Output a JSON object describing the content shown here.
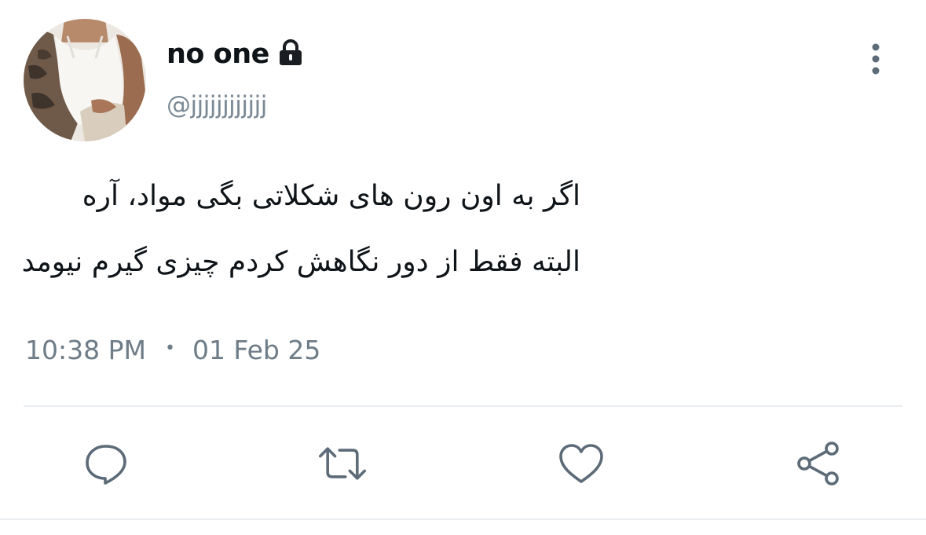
{
  "user": {
    "display_name": "no one",
    "handle": "@jjjjjjjjjjjj",
    "protected_icon": "lock-icon",
    "avatar": "profile-photo"
  },
  "tweet": {
    "lines": [
      "اگر به اون رون های شکلاتی بگی مواد، آره",
      "البته فقط از دور نگاهش کردم چیزی گیرم نیومد"
    ],
    "time": "10:38 PM",
    "separator": "•",
    "date": "01 Feb 25"
  },
  "menu_icon": "more-vertical-icon",
  "actions": [
    {
      "icon": "reply-icon"
    },
    {
      "icon": "retweet-icon"
    },
    {
      "icon": "like-icon"
    },
    {
      "icon": "share-icon"
    }
  ],
  "colors": {
    "text_primary": "#0f1419",
    "text_secondary": "#6e7c88",
    "icon": "#5d6b78",
    "divider": "#e9edf0",
    "background": "#ffffff"
  }
}
